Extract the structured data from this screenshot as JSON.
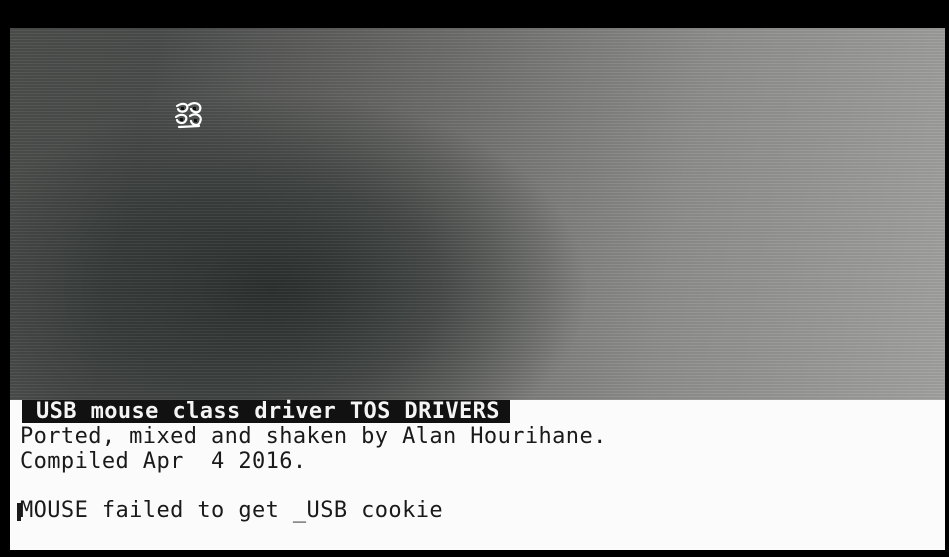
{
  "console": {
    "banner": "USB mouse class driver TOS DRIVERS",
    "lines": [
      "Ported, mixed and shaken by Alan Hourihane.",
      "Compiled Apr  4 2016.",
      "MOUSE failed to get _USB cookie"
    ]
  },
  "icons": {
    "pointer": "busy-bee-icon"
  }
}
